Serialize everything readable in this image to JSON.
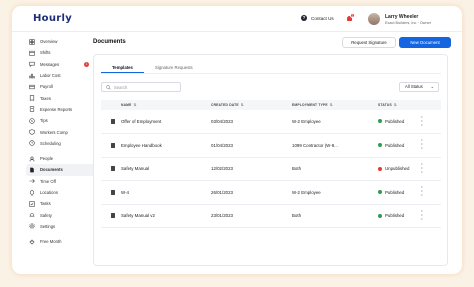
{
  "app": {
    "logo": "Hourly"
  },
  "header": {
    "contact": "Contact Us",
    "notification_count": "1",
    "user_name": "Larry Wheeler",
    "user_role": "Exact Builders, Inc · Owner"
  },
  "sidebar": {
    "items": [
      {
        "label": "Overview",
        "icon": "grid-icon"
      },
      {
        "label": "Shifts",
        "icon": "calendar-icon"
      },
      {
        "label": "Messages",
        "icon": "chat-icon",
        "count": "1"
      },
      {
        "label": "Labor Cost",
        "icon": "chart-icon"
      },
      {
        "label": "Payroll",
        "icon": "wallet-icon"
      },
      {
        "label": "Taxes",
        "icon": "receipt-icon"
      },
      {
        "label": "Expense Reports",
        "icon": "report-icon"
      },
      {
        "label": "Tips",
        "icon": "dollar-icon"
      },
      {
        "label": "Workers Comp",
        "icon": "shield-icon"
      },
      {
        "label": "Scheduling",
        "icon": "clock-icon"
      },
      {
        "label": "People",
        "icon": "people-icon"
      },
      {
        "label": "Documents",
        "icon": "document-icon",
        "active": true
      },
      {
        "label": "Time Off",
        "icon": "plane-icon"
      },
      {
        "label": "Locations",
        "icon": "pin-icon"
      },
      {
        "label": "Tasks",
        "icon": "check-icon"
      },
      {
        "label": "Safety",
        "icon": "hardhat-icon"
      },
      {
        "label": "Settings",
        "icon": "gear-icon"
      },
      {
        "label": "Free Month",
        "icon": "gift-icon"
      }
    ]
  },
  "main": {
    "title": "Documents",
    "request_signature": "Request Signature",
    "new_document": "New Document"
  },
  "tabs": [
    "Templates",
    "Signature Requests"
  ],
  "search": {
    "placeholder": "Search"
  },
  "filter": {
    "value": "All Status"
  },
  "table": {
    "headers": [
      "NAME",
      "CREATED DATE",
      "EMPLOYMENT TYPE",
      "STATUS"
    ],
    "rows": [
      {
        "name": "Offer of Employment",
        "date": "03/04/2023",
        "type": "W-2 Employee",
        "status": "Published"
      },
      {
        "name": "Employee Handbook",
        "date": "01/04/2023",
        "type": "1099 Contractor (W-9...",
        "status": "Published"
      },
      {
        "name": "Safety Manual",
        "date": "12/02/2023",
        "type": "Both",
        "status": "Unpublished"
      },
      {
        "name": "W-4",
        "date": "26/01/2023",
        "type": "W-2 Employee",
        "status": "Published"
      },
      {
        "name": "Safety Manual v2",
        "date": "23/01/2023",
        "type": "Both",
        "status": "Published"
      }
    ]
  },
  "colors": {
    "accent": "#1565e0",
    "published": "#2e9d4f",
    "unpublished": "#e53935",
    "logo": "#1d2f7a"
  }
}
